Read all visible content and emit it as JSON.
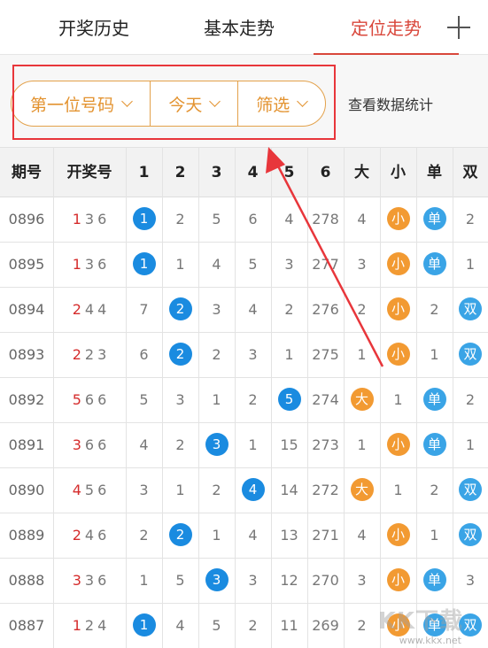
{
  "tabs": [
    {
      "label": "开奖历史"
    },
    {
      "label": "基本走势"
    },
    {
      "label": "定位走势"
    }
  ],
  "filters": {
    "position": "第一位号码",
    "date": "今天",
    "filter": "筛选",
    "stats_link": "查看数据统计"
  },
  "colors": {
    "accent_red": "#d9473b",
    "pill_orange": "#e39330",
    "ball_blue": "#1a8be0",
    "ball_orange": "#f29a32"
  },
  "table": {
    "headers": [
      "期号",
      "开奖号",
      "1",
      "2",
      "3",
      "4",
      "5",
      "6",
      "大",
      "小",
      "单",
      "双"
    ],
    "rows": [
      {
        "period": "0896",
        "draw": [
          "1",
          "3",
          "6"
        ],
        "cells": [
          {
            "t": "1",
            "ball": "blue"
          },
          {
            "t": "2"
          },
          {
            "t": "5"
          },
          {
            "t": "6"
          },
          {
            "t": "4"
          },
          {
            "t": "278"
          },
          {
            "t": "4"
          },
          {
            "t": "小",
            "ball": "orange"
          },
          {
            "t": "单",
            "ball": "sky"
          },
          {
            "t": "2"
          }
        ]
      },
      {
        "period": "0895",
        "draw": [
          "1",
          "3",
          "6"
        ],
        "cells": [
          {
            "t": "1",
            "ball": "blue"
          },
          {
            "t": "1"
          },
          {
            "t": "4"
          },
          {
            "t": "5"
          },
          {
            "t": "3"
          },
          {
            "t": "277"
          },
          {
            "t": "3"
          },
          {
            "t": "小",
            "ball": "orange"
          },
          {
            "t": "单",
            "ball": "sky"
          },
          {
            "t": "1"
          }
        ]
      },
      {
        "period": "0894",
        "draw": [
          "2",
          "4",
          "4"
        ],
        "cells": [
          {
            "t": "7"
          },
          {
            "t": "2",
            "ball": "blue"
          },
          {
            "t": "3"
          },
          {
            "t": "4"
          },
          {
            "t": "2"
          },
          {
            "t": "276"
          },
          {
            "t": "2"
          },
          {
            "t": "小",
            "ball": "orange"
          },
          {
            "t": "2"
          },
          {
            "t": "双",
            "ball": "sky"
          }
        ]
      },
      {
        "period": "0893",
        "draw": [
          "2",
          "2",
          "3"
        ],
        "cells": [
          {
            "t": "6"
          },
          {
            "t": "2",
            "ball": "blue"
          },
          {
            "t": "2"
          },
          {
            "t": "3"
          },
          {
            "t": "1"
          },
          {
            "t": "275"
          },
          {
            "t": "1"
          },
          {
            "t": "小",
            "ball": "orange"
          },
          {
            "t": "1"
          },
          {
            "t": "双",
            "ball": "sky"
          }
        ]
      },
      {
        "period": "0892",
        "draw": [
          "5",
          "6",
          "6"
        ],
        "cells": [
          {
            "t": "5"
          },
          {
            "t": "3"
          },
          {
            "t": "1"
          },
          {
            "t": "2"
          },
          {
            "t": "5",
            "ball": "blue"
          },
          {
            "t": "274"
          },
          {
            "t": "大",
            "ball": "orange"
          },
          {
            "t": "1"
          },
          {
            "t": "单",
            "ball": "sky"
          },
          {
            "t": "2"
          }
        ]
      },
      {
        "period": "0891",
        "draw": [
          "3",
          "6",
          "6"
        ],
        "cells": [
          {
            "t": "4"
          },
          {
            "t": "2"
          },
          {
            "t": "3",
            "ball": "blue"
          },
          {
            "t": "1"
          },
          {
            "t": "15"
          },
          {
            "t": "273"
          },
          {
            "t": "1"
          },
          {
            "t": "小",
            "ball": "orange"
          },
          {
            "t": "单",
            "ball": "sky"
          },
          {
            "t": "1"
          }
        ]
      },
      {
        "period": "0890",
        "draw": [
          "4",
          "5",
          "6"
        ],
        "cells": [
          {
            "t": "3"
          },
          {
            "t": "1"
          },
          {
            "t": "2"
          },
          {
            "t": "4",
            "ball": "blue"
          },
          {
            "t": "14"
          },
          {
            "t": "272"
          },
          {
            "t": "大",
            "ball": "orange"
          },
          {
            "t": "1"
          },
          {
            "t": "2"
          },
          {
            "t": "双",
            "ball": "sky"
          }
        ]
      },
      {
        "period": "0889",
        "draw": [
          "2",
          "4",
          "6"
        ],
        "cells": [
          {
            "t": "2"
          },
          {
            "t": "2",
            "ball": "blue"
          },
          {
            "t": "1"
          },
          {
            "t": "4"
          },
          {
            "t": "13"
          },
          {
            "t": "271"
          },
          {
            "t": "4"
          },
          {
            "t": "小",
            "ball": "orange"
          },
          {
            "t": "1"
          },
          {
            "t": "双",
            "ball": "sky"
          }
        ]
      },
      {
        "period": "0888",
        "draw": [
          "3",
          "3",
          "6"
        ],
        "cells": [
          {
            "t": "1"
          },
          {
            "t": "5"
          },
          {
            "t": "3",
            "ball": "blue"
          },
          {
            "t": "3"
          },
          {
            "t": "12"
          },
          {
            "t": "270"
          },
          {
            "t": "3"
          },
          {
            "t": "小",
            "ball": "orange"
          },
          {
            "t": "单",
            "ball": "sky"
          },
          {
            "t": "3"
          }
        ]
      },
      {
        "period": "0887",
        "draw": [
          "1",
          "2",
          "4"
        ],
        "cells": [
          {
            "t": "1",
            "ball": "blue"
          },
          {
            "t": "4"
          },
          {
            "t": "5"
          },
          {
            "t": "2"
          },
          {
            "t": "11"
          },
          {
            "t": "269"
          },
          {
            "t": "2"
          },
          {
            "t": "小",
            "ball": "orange"
          },
          {
            "t": "单",
            "ball": "sky"
          },
          {
            "t": "双",
            "ball": "sky"
          }
        ]
      }
    ]
  },
  "watermark": {
    "text": "KK下载",
    "url": "www.kkx.net"
  }
}
